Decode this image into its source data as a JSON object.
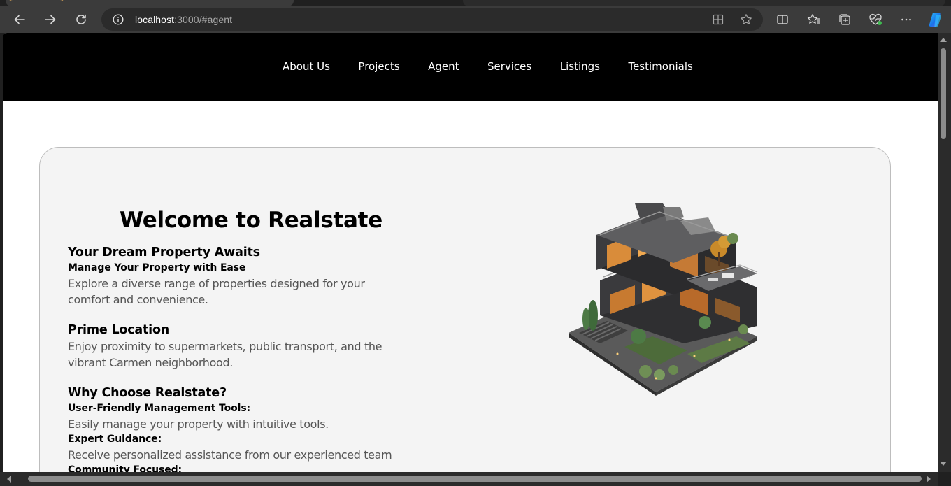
{
  "browser": {
    "url_host": "localhost",
    "url_path": ":3000/#agent",
    "icons": {
      "back": "back-arrow-icon",
      "forward": "forward-arrow-icon",
      "reload": "reload-icon",
      "info": "info-icon",
      "app": "app-available-icon",
      "favorite": "star-icon",
      "split": "split-screen-icon",
      "favorites": "favorites-icon",
      "collections": "collections-icon",
      "health": "browser-essentials-icon",
      "more": "more-icon",
      "copilot": "copilot-icon"
    }
  },
  "nav": {
    "items": [
      {
        "label": "About Us"
      },
      {
        "label": "Projects"
      },
      {
        "label": "Agent"
      },
      {
        "label": "Services"
      },
      {
        "label": "Listings"
      },
      {
        "label": "Testimonials"
      }
    ]
  },
  "hero": {
    "title": "Welcome to Realstate",
    "section1": {
      "heading": "Your Dream Property Awaits",
      "subheading": "Manage Your Property with Ease",
      "text_line1": "Explore a diverse range of properties designed for your",
      "text_line2": "comfort and convenience."
    },
    "section2": {
      "heading": "Prime Location",
      "text_line1": "Enjoy proximity to supermarkets, public transport, and the",
      "text_line2": "vibrant Carmen neighborhood."
    },
    "section3": {
      "heading": "Why Choose Realstate?",
      "items": [
        {
          "title": "User-Friendly Management Tools:",
          "text": "Easily manage your property with intuitive tools."
        },
        {
          "title": "Expert Guidance:",
          "text": "Receive personalized assistance from our experienced team"
        },
        {
          "title": "Community Focused:"
        }
      ]
    }
  },
  "colors": {
    "navbar": "#000000",
    "card": "#f4f4f4",
    "body_text": "#555555"
  }
}
